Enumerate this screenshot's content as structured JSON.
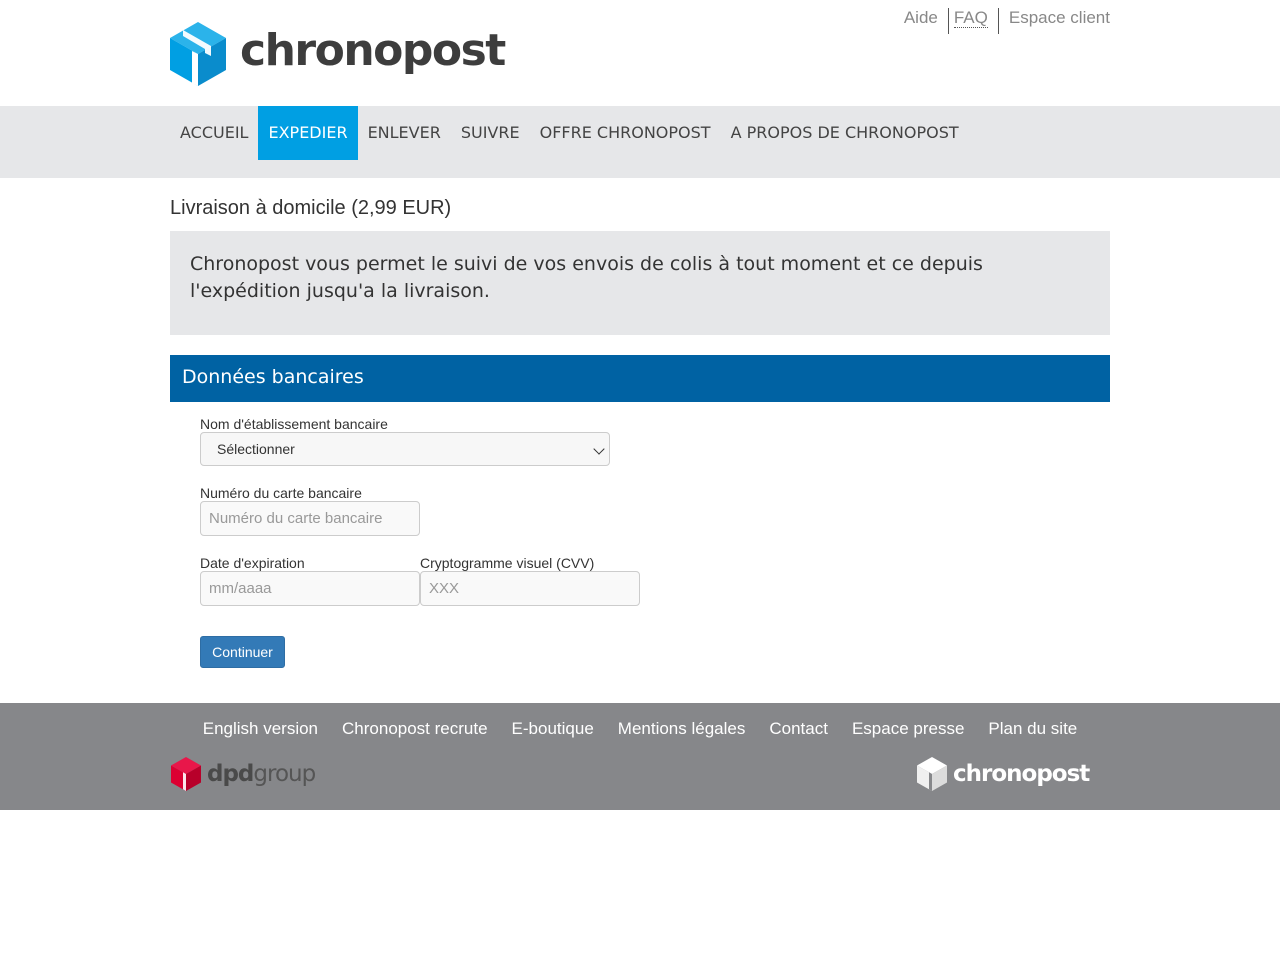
{
  "header": {
    "logo_text": "chronopost",
    "top_links": {
      "aide": "Aide",
      "faq": "FAQ",
      "espace_client": "Espace client"
    }
  },
  "nav": {
    "items": [
      {
        "label": "ACCUEIL",
        "active": false
      },
      {
        "label": "EXPEDIER",
        "active": true
      },
      {
        "label": "ENLEVER",
        "active": false
      },
      {
        "label": "SUIVRE",
        "active": false
      },
      {
        "label": "OFFRE CHRONOPOST",
        "active": false
      },
      {
        "label": "A PROPOS DE CHRONOPOST",
        "active": false
      }
    ]
  },
  "main": {
    "heading": "Livraison à domicile (2,99 EUR)",
    "intro": "Chronopost vous permet le suivi de vos envois de colis à tout moment et ce depuis l'expédition jusqu'a la livraison.",
    "section_title": "Données bancaires",
    "form": {
      "bank_label": "Nom d'établissement bancaire",
      "bank_value": "Sélectionner",
      "card_label": "Numéro du carte bancaire",
      "card_placeholder": "Numéro du carte bancaire",
      "expiry_label": "Date d'expiration",
      "expiry_placeholder": "mm/aaaa",
      "cvv_label": "Cryptogramme visuel (CVV)",
      "cvv_placeholder": "XXX",
      "submit_label": "Continuer"
    }
  },
  "footer": {
    "links": [
      "English version",
      "Chronopost recrute",
      "E-boutique",
      "Mentions légales",
      "Contact",
      "Espace presse",
      "Plan du site"
    ],
    "dpd_brand": "dpd",
    "dpd_group": "group",
    "chronopost_brand": "chronopost"
  },
  "colors": {
    "brand_blue": "#009fe3",
    "section_blue": "#0062a3",
    "button_blue": "#337ab7",
    "dpd_red": "#dc0032",
    "footer_gray": "#86878a",
    "nav_gray": "#e6e7e9"
  }
}
